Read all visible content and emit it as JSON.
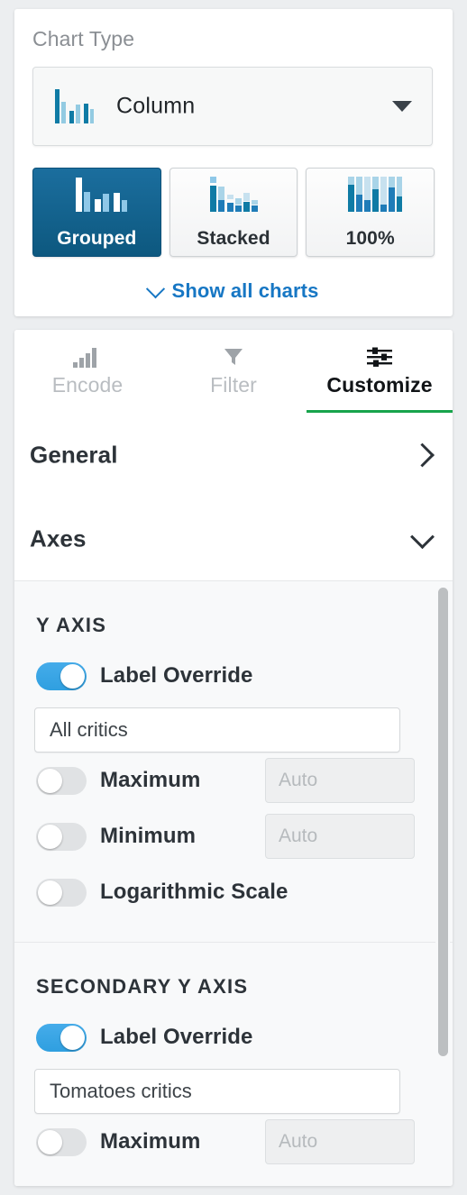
{
  "chart_type": {
    "title": "Chart Type",
    "selected": {
      "label": "Column",
      "icon": "column-chart-icon",
      "caret": "chevron-down-icon"
    },
    "variants": [
      {
        "label": "Grouped",
        "icon": "grouped-column-icon",
        "active": true
      },
      {
        "label": "Stacked",
        "icon": "stacked-column-icon",
        "active": false
      },
      {
        "label": "100%",
        "icon": "percent-stacked-column-icon",
        "active": false
      }
    ],
    "show_all": {
      "label": "Show all charts",
      "icon": "chevron-down-icon",
      "color": "#1777c4"
    }
  },
  "tabs": [
    {
      "label": "Encode",
      "icon": "bar-levels-icon",
      "active": false
    },
    {
      "label": "Filter",
      "icon": "funnel-icon",
      "active": false
    },
    {
      "label": "Customize",
      "icon": "sliders-icon",
      "active": true
    }
  ],
  "sections": [
    {
      "label": "General",
      "icon": "chevron-right-icon",
      "expanded": false
    },
    {
      "label": "Axes",
      "icon": "chevron-down-icon",
      "expanded": true
    }
  ],
  "axes": [
    {
      "heading": "Y AXIS",
      "options": [
        {
          "label": "Label Override",
          "toggle": true,
          "field_type": "text",
          "value": "All critics",
          "placeholder": ""
        },
        {
          "label": "Maximum",
          "toggle": false,
          "field_type": "inline",
          "value": "",
          "placeholder": "Auto"
        },
        {
          "label": "Minimum",
          "toggle": false,
          "field_type": "inline",
          "value": "",
          "placeholder": "Auto"
        },
        {
          "label": "Logarithmic Scale",
          "toggle": false,
          "field_type": "none",
          "value": "",
          "placeholder": ""
        }
      ]
    },
    {
      "heading": "SECONDARY Y AXIS",
      "options": [
        {
          "label": "Label Override",
          "toggle": true,
          "field_type": "text",
          "value": "Tomatoes critics",
          "placeholder": ""
        },
        {
          "label": "Maximum",
          "toggle": false,
          "field_type": "inline",
          "value": "",
          "placeholder": "Auto"
        }
      ]
    }
  ],
  "colors": {
    "accent_blue": "#1777c4",
    "active_tab_underline": "#17a44c",
    "toggle_on": "#2f9fe0",
    "selected_variant": "#0d587f",
    "bar_dark": "#0f7ba5",
    "bar_light": "#93cbe2"
  },
  "scrollbar": {
    "name": "vertical-scrollbar"
  }
}
